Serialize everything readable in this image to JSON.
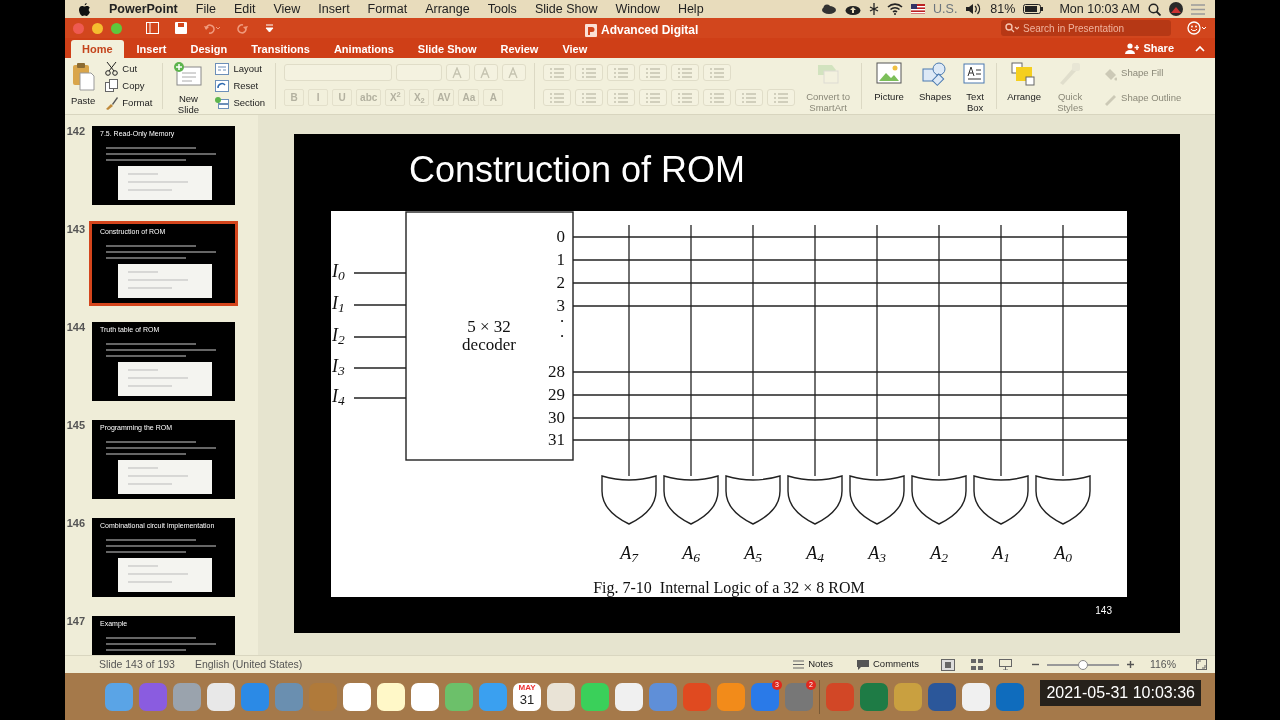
{
  "menubar": {
    "app": "PowerPoint",
    "menus": [
      "File",
      "Edit",
      "View",
      "Insert",
      "Format",
      "Arrange",
      "Tools",
      "Slide Show",
      "Window",
      "Help"
    ],
    "keyboard": "U.S.",
    "battery": "81%",
    "clock": "Mon 10:03 AM"
  },
  "window": {
    "title": "Advanced Digital",
    "search": {
      "placeholder": "Search in Presentation"
    },
    "share": "Share"
  },
  "tabs": [
    {
      "label": "Home",
      "selected": true
    },
    {
      "label": "Insert",
      "selected": false
    },
    {
      "label": "Design",
      "selected": false
    },
    {
      "label": "Transitions",
      "selected": false
    },
    {
      "label": "Animations",
      "selected": false
    },
    {
      "label": "Slide Show",
      "selected": false
    },
    {
      "label": "Review",
      "selected": false
    },
    {
      "label": "View",
      "selected": false
    }
  ],
  "ribbon": {
    "paste": "Paste",
    "clipboard": [
      "Cut",
      "Copy",
      "Format"
    ],
    "new_slide": "New Slide",
    "slide_buttons": [
      "Layout",
      "Reset",
      "Section"
    ],
    "font_buttons": [
      "B",
      "I",
      "U",
      "abc",
      "X$^{2}$",
      "X$_{2}$",
      "AV",
      "Aa",
      "A"
    ],
    "tools": [
      {
        "kind": "smartart",
        "label": "Convert to SmartArt",
        "disabled": true
      },
      {
        "kind": "picture",
        "label": "Picture",
        "disabled": false
      },
      {
        "kind": "shapes",
        "label": "Shapes",
        "disabled": false
      },
      {
        "kind": "textbox",
        "label": "Text Box",
        "disabled": false
      },
      {
        "kind": "arrange",
        "label": "Arrange",
        "disabled": false
      },
      {
        "kind": "styles",
        "label": "Quick Styles",
        "disabled": true
      }
    ],
    "shape_format": [
      {
        "label": "Shape Fill",
        "disabled": true
      },
      {
        "label": "Shape Outline",
        "disabled": true
      }
    ]
  },
  "thumbnails": [
    {
      "number": "142",
      "title": "7.5. Read-Only Memory",
      "selected": false
    },
    {
      "number": "143",
      "title": "Construction of ROM",
      "selected": true
    },
    {
      "number": "144",
      "title": "Truth table of ROM",
      "selected": false
    },
    {
      "number": "145",
      "title": "Programming the ROM",
      "selected": false
    },
    {
      "number": "146",
      "title": "Combinational circuit implementation",
      "selected": false
    },
    {
      "number": "147",
      "title": "Example",
      "selected": false
    }
  ],
  "slide": {
    "title": "Construction of ROM",
    "inputs": [
      "I$_{0}$",
      "I$_{1}$",
      "I$_{2}$",
      "I$_{3}$",
      "I$_{4}$"
    ],
    "decoder_label": [
      "5 × 32",
      "decoder"
    ],
    "outputs": [
      "0",
      "1",
      "2",
      "3",
      "·",
      "·",
      "28",
      "29",
      "30",
      "31"
    ],
    "gate_labels": [
      "A$_{7}$",
      "A$_{6}$",
      "A$_{5}$",
      "A$_{4}$",
      "A$_{3}$",
      "A$_{2}$",
      "A$_{1}$",
      "A$_{0}$"
    ],
    "caption": "Fig. 7-10  Internal Logic of a 32 × 8 ROM",
    "number": "143"
  },
  "status_bar": {
    "slide": "Slide 143 of 193",
    "language": "English (United States)",
    "notes": "Notes",
    "comments": "Comments",
    "zoom": "116%",
    "zoom_slider": {
      "level": 0.5
    }
  },
  "dock": {
    "calendar_month": "MAY",
    "calendar_day": "31",
    "badges": [
      "3",
      "2"
    ]
  },
  "timestamp": "2021-05-31 10:03:36"
}
